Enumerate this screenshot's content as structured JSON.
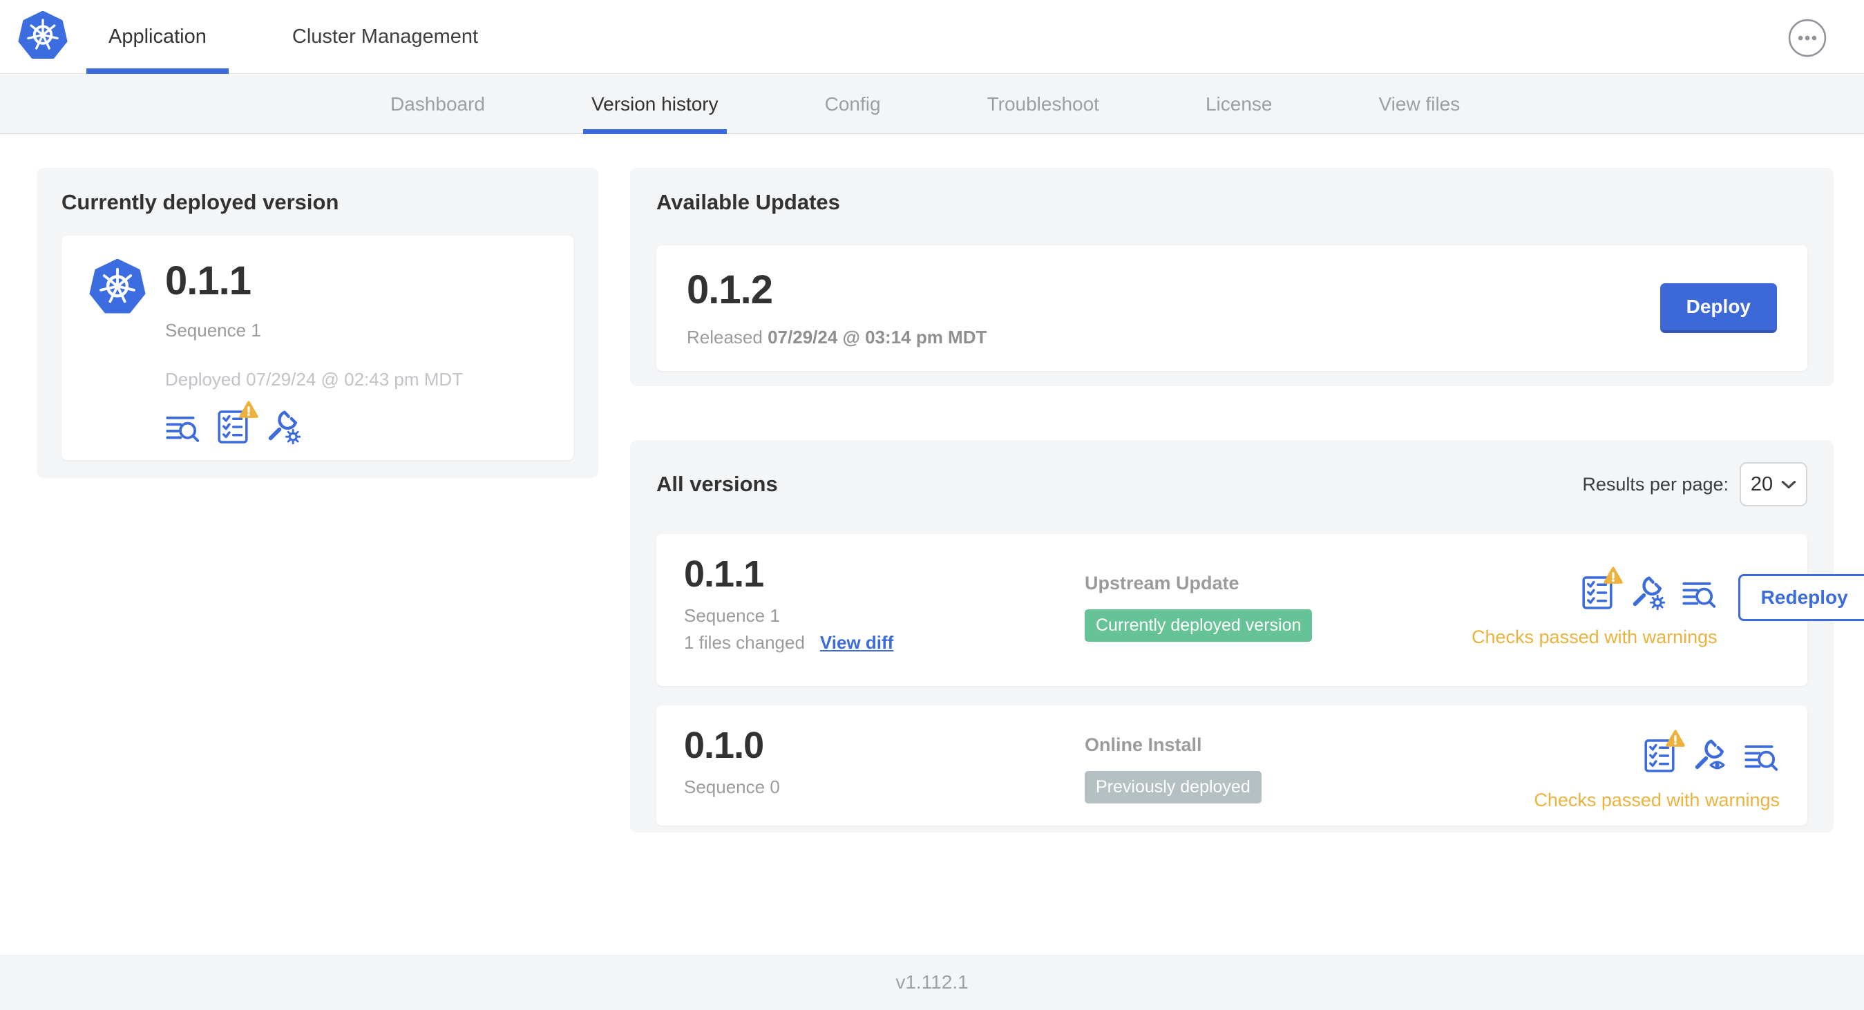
{
  "header": {
    "tabs": [
      {
        "label": "Application"
      },
      {
        "label": "Cluster Management"
      }
    ]
  },
  "subnav": {
    "tabs": [
      {
        "label": "Dashboard"
      },
      {
        "label": "Version history"
      },
      {
        "label": "Config"
      },
      {
        "label": "Troubleshoot"
      },
      {
        "label": "License"
      },
      {
        "label": "View files"
      }
    ],
    "active_tab": "Version history"
  },
  "current_version": {
    "title": "Currently deployed version",
    "version": "0.1.1",
    "sequence": "Sequence 1",
    "deployed": "Deployed 07/29/24 @ 02:43 pm MDT"
  },
  "available_updates": {
    "title": "Available Updates",
    "version": "0.1.2",
    "released_label": "Released",
    "released_date": "07/29/24 @ 03:14 pm MDT",
    "deploy_label": "Deploy"
  },
  "all_versions": {
    "title": "All versions",
    "results_per_page_label": "Results per page:",
    "results_per_page_value": "20",
    "rows": [
      {
        "version": "0.1.1",
        "sequence": "Sequence 1",
        "files_changed": "1 files changed",
        "view_diff_label": "View diff",
        "source": "Upstream Update",
        "badge": "Currently deployed version",
        "checks_status": "Checks passed with warnings",
        "action_label": "Redeploy"
      },
      {
        "version": "0.1.0",
        "sequence": "Sequence 0",
        "source": "Online Install",
        "badge": "Previously deployed",
        "checks_status": "Checks passed with warnings"
      }
    ]
  },
  "footer": {
    "version_label": "v1.112.1"
  },
  "colors": {
    "accent_blue": "#3b6bdc",
    "k8s_blue": "#3b6de0",
    "green_badge": "#66c397",
    "gray_badge": "#b5c0c3",
    "warning_orange": "#ebb23e",
    "deploy_button_blue": "#3c68d8"
  }
}
